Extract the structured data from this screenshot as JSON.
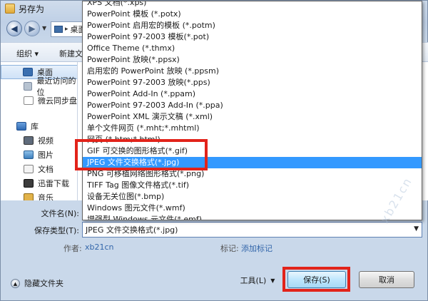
{
  "window": {
    "title": "另存为"
  },
  "nav": {
    "address": "桌面"
  },
  "toolbar": {
    "organize": "组织 ▾",
    "new_folder": "新建文"
  },
  "sidebar": {
    "items": [
      {
        "label": "桌面",
        "icon": "desktop-icon"
      },
      {
        "label": "最近访问的位",
        "icon": "recent-places-icon"
      },
      {
        "label": "微云同步盘",
        "icon": "cloud-sync-icon"
      },
      {
        "label": "库",
        "icon": "library-icon"
      },
      {
        "label": "视频",
        "icon": "video-library-icon"
      },
      {
        "label": "图片",
        "icon": "pictures-library-icon"
      },
      {
        "label": "文档",
        "icon": "documents-library-icon"
      },
      {
        "label": "迅雷下载",
        "icon": "thunder-download-icon"
      },
      {
        "label": "音乐",
        "icon": "music-library-icon"
      }
    ]
  },
  "file_types": [
    "XPS 文档(*.xps)",
    "PowerPoint 模板 (*.potx)",
    "PowerPoint 启用宏的模板 (*.potm)",
    "PowerPoint 97-2003 模板(*.pot)",
    "Office Theme (*.thmx)",
    "PowerPoint 放映(*.ppsx)",
    "启用宏的 PowerPoint 放映 (*.ppsm)",
    "PowerPoint 97-2003 放映(*.pps)",
    "PowerPoint Add-In (*.ppam)",
    "PowerPoint 97-2003 Add-In (*.ppa)",
    "PowerPoint XML 演示文稿 (*.xml)",
    "单个文件网页 (*.mht;*.mhtml)",
    "网页 (*.htm;*.html)",
    "GIF 可交换的图形格式(*.gif)",
    "JPEG 文件交换格式(*.jpg)",
    "PNG 可移植网络图形格式(*.png)",
    "TIFF Tag 图像文件格式(*.tif)",
    "设备无关位图(*.bmp)",
    "Windows 图元文件(*.wmf)",
    "增强型 Windows 元文件(*.emf)",
    "大纲/RTF 文件(*.rtf)"
  ],
  "selected_type_index": 14,
  "form": {
    "filename_label": "文件名(N):",
    "filename_value": "",
    "type_label": "保存类型(T):",
    "type_value": "JPEG 文件交换格式(*.jpg)"
  },
  "meta": {
    "author_label": "作者:",
    "author_value": "xb21cn",
    "tags_label": "标记:",
    "tags_value": "添加标记"
  },
  "footer": {
    "hide_folders": "隐藏文件夹",
    "tools": "工具(L)",
    "save": "保存(S)",
    "cancel": "取消"
  },
  "watermark": "xb21cn",
  "colors": {
    "highlight_box": "#e2231a",
    "selection": "#3399ff"
  }
}
